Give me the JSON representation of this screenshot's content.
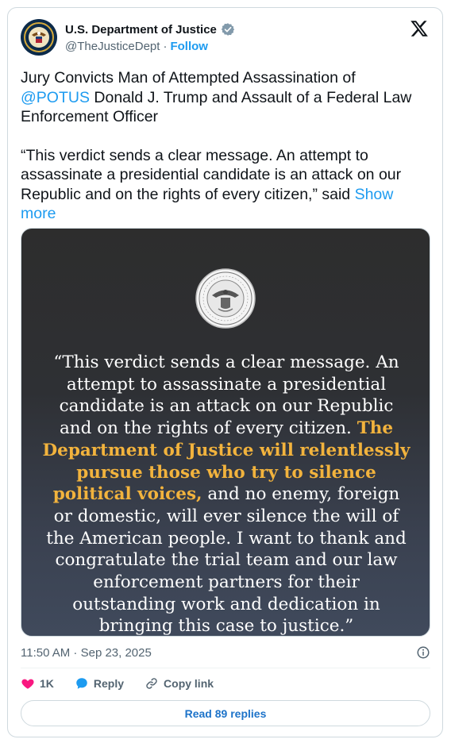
{
  "author": {
    "name": "U.S. Department of Justice",
    "handle": "@TheJusticeDept",
    "separator": "·",
    "follow_label": "Follow",
    "verified_color": "#829aab"
  },
  "tweet": {
    "line1_prefix": "Jury Convicts Man of Attempted Assassination of ",
    "mention": "@POTUS",
    "line1_suffix": " Donald J. Trump and Assault of a Federal Law Enforcement Officer",
    "para2": "“This verdict sends a clear message. An attempt to assassinate a presidential candidate is an attack on our Republic and on the rights of every citizen,” said ",
    "show_more": "Show more"
  },
  "media": {
    "quote_part1": "“This verdict sends a clear message. An attempt to assassinate a presidential candidate is an attack on our Republic and on the rights of every citizen. ",
    "quote_highlight": "The Department of Justice will relentlessly pursue those who try to silence political voices,",
    "quote_part2": " and no enemy, foreign or domestic, will ever silence the will of the American people. I want to thank and congratulate the trial team and our law enforcement partners for their outstanding work and dedication in bringing this case to justice.”",
    "highlight_color": "#f2b33d"
  },
  "footer": {
    "timestamp": "11:50 AM · Sep 23, 2025",
    "likes": "1K",
    "reply_label": "Reply",
    "copy_label": "Copy link",
    "read_replies": "Read 89 replies",
    "like_color": "#f91880",
    "reply_color": "#1d9bf0"
  }
}
